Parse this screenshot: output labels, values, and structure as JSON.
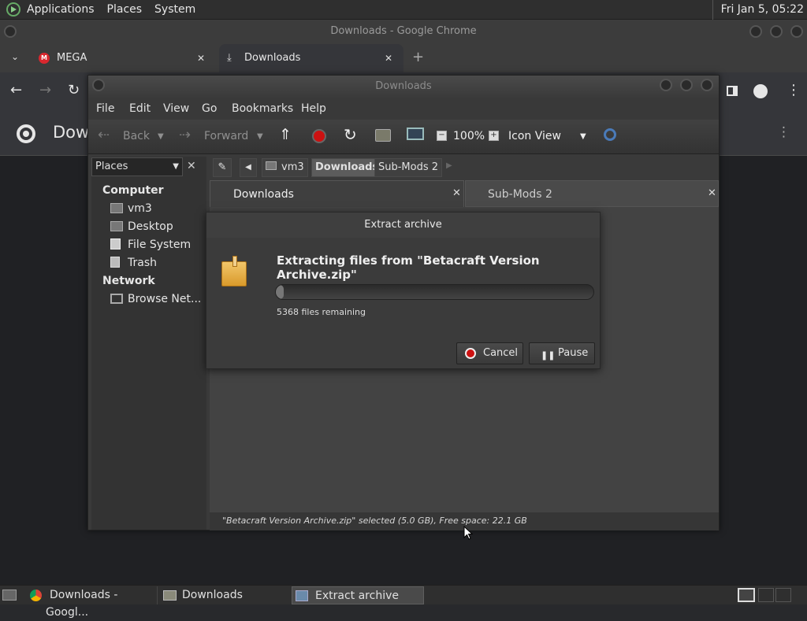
{
  "top_panel": {
    "menus": [
      "Applications",
      "Places",
      "System"
    ],
    "clock": "Fri Jan  5, 05:22"
  },
  "chrome": {
    "title": "Downloads - Google Chrome",
    "tabs": [
      {
        "label": "MEGA"
      },
      {
        "label": "Downloads"
      }
    ],
    "page_heading": "Dow"
  },
  "file_manager": {
    "title": "Downloads",
    "menu": [
      "File",
      "Edit",
      "View",
      "Go",
      "Bookmarks",
      "Help"
    ],
    "toolbar": {
      "back": "Back",
      "forward": "Forward",
      "zoom": "100%",
      "view_mode": "Icon View"
    },
    "sidebar": {
      "dropdown": "Places",
      "sections": [
        {
          "heading": "Computer",
          "items": [
            "vm3",
            "Desktop",
            "File System",
            "Trash"
          ]
        },
        {
          "heading": "Network",
          "items": [
            "Browse Net..."
          ]
        }
      ]
    },
    "path": [
      "vm3",
      "Downloads",
      "Sub-Mods 2"
    ],
    "tabs": [
      "Downloads",
      "Sub-Mods 2"
    ],
    "status": "\"Betacraft Version Archive.zip\" selected (5.0 GB), Free space: 22.1 GB"
  },
  "dialog": {
    "title": "Extract archive",
    "heading": "Extracting files from \"Betacraft Version Archive.zip\"",
    "progress": 0.02,
    "remaining": "5368 files remaining",
    "cancel": "Cancel",
    "pause": "Pause"
  },
  "taskbar": {
    "items": [
      "Downloads - Googl...",
      "Downloads",
      "Extract archive"
    ]
  },
  "colors": {
    "accent_red": "#cc1111",
    "panel": "#2f2f2f",
    "window": "#3a3a3a"
  }
}
